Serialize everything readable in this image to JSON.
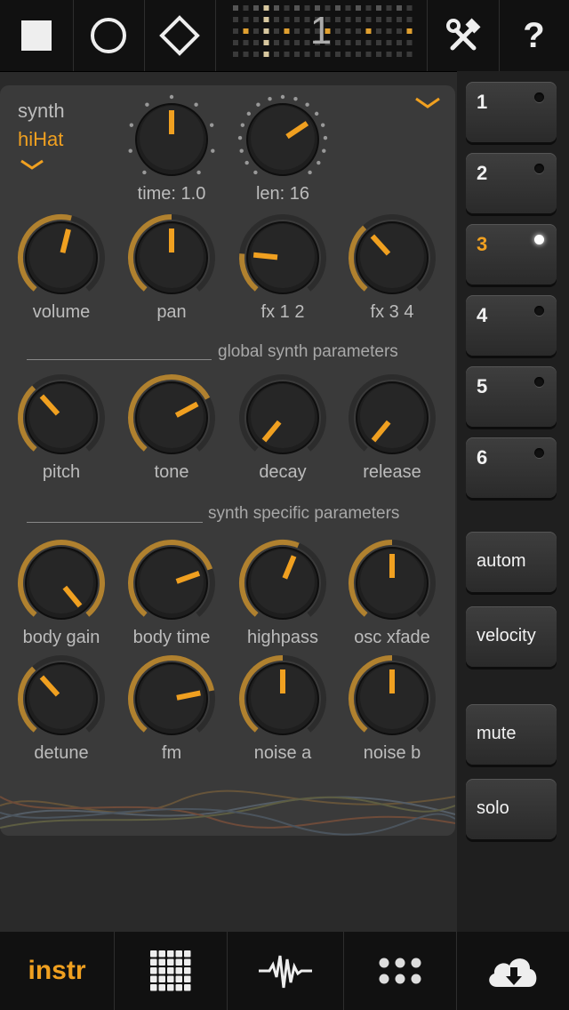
{
  "topbar": {
    "stop_icon": "stop-icon",
    "record_icon": "circle-icon",
    "play_icon": "diamond-icon",
    "pattern_number": "1",
    "tools_icon": "tools-icon",
    "help_icon": "help-icon"
  },
  "instrument": {
    "type_label": "synth",
    "preset_label": "hiHat"
  },
  "top_knobs": [
    {
      "label": "time: 1.0",
      "value": 0.5
    },
    {
      "label": "len: 16",
      "value": 0.7
    }
  ],
  "row1_knobs": [
    {
      "label": "volume",
      "value": 0.55
    },
    {
      "label": "pan",
      "value": 0.5
    },
    {
      "label": "fx 1 2",
      "value": 0.2
    },
    {
      "label": "fx 3 4",
      "value": 0.35
    }
  ],
  "global_section_title": "global synth parameters",
  "row2_knobs": [
    {
      "label": "pitch",
      "value": 0.35
    },
    {
      "label": "tone",
      "value": 0.72
    },
    {
      "label": "decay",
      "value": 0.0
    },
    {
      "label": "release",
      "value": 0.0
    }
  ],
  "synth_section_title": "synth specific parameters",
  "row3_knobs": [
    {
      "label": "body gain",
      "value": 1.0
    },
    {
      "label": "body time",
      "value": 0.75
    },
    {
      "label": "highpass",
      "value": 0.58
    },
    {
      "label": "osc xfade",
      "value": 0.5
    }
  ],
  "row4_knobs": [
    {
      "label": "detune",
      "value": 0.35
    },
    {
      "label": "fm",
      "value": 0.78
    },
    {
      "label": "noise a",
      "value": 0.5
    },
    {
      "label": "noise b",
      "value": 0.5
    }
  ],
  "side_buttons": {
    "tracks": [
      {
        "label": "1",
        "active": false
      },
      {
        "label": "2",
        "active": false
      },
      {
        "label": "3",
        "active": true
      },
      {
        "label": "4",
        "active": false
      },
      {
        "label": "5",
        "active": false
      },
      {
        "label": "6",
        "active": false
      }
    ],
    "autom": "autom",
    "velocity": "velocity",
    "mute": "mute",
    "solo": "solo"
  },
  "bottombar": {
    "instr_label": "instr",
    "grid_icon": "grid-icon",
    "waveform_icon": "waveform-icon",
    "dots_icon": "dots-icon",
    "cloud_icon": "cloud-download-icon"
  },
  "colors": {
    "accent": "#f0a020",
    "background": "#2a2a2a",
    "panel": "#3a3a3a"
  }
}
